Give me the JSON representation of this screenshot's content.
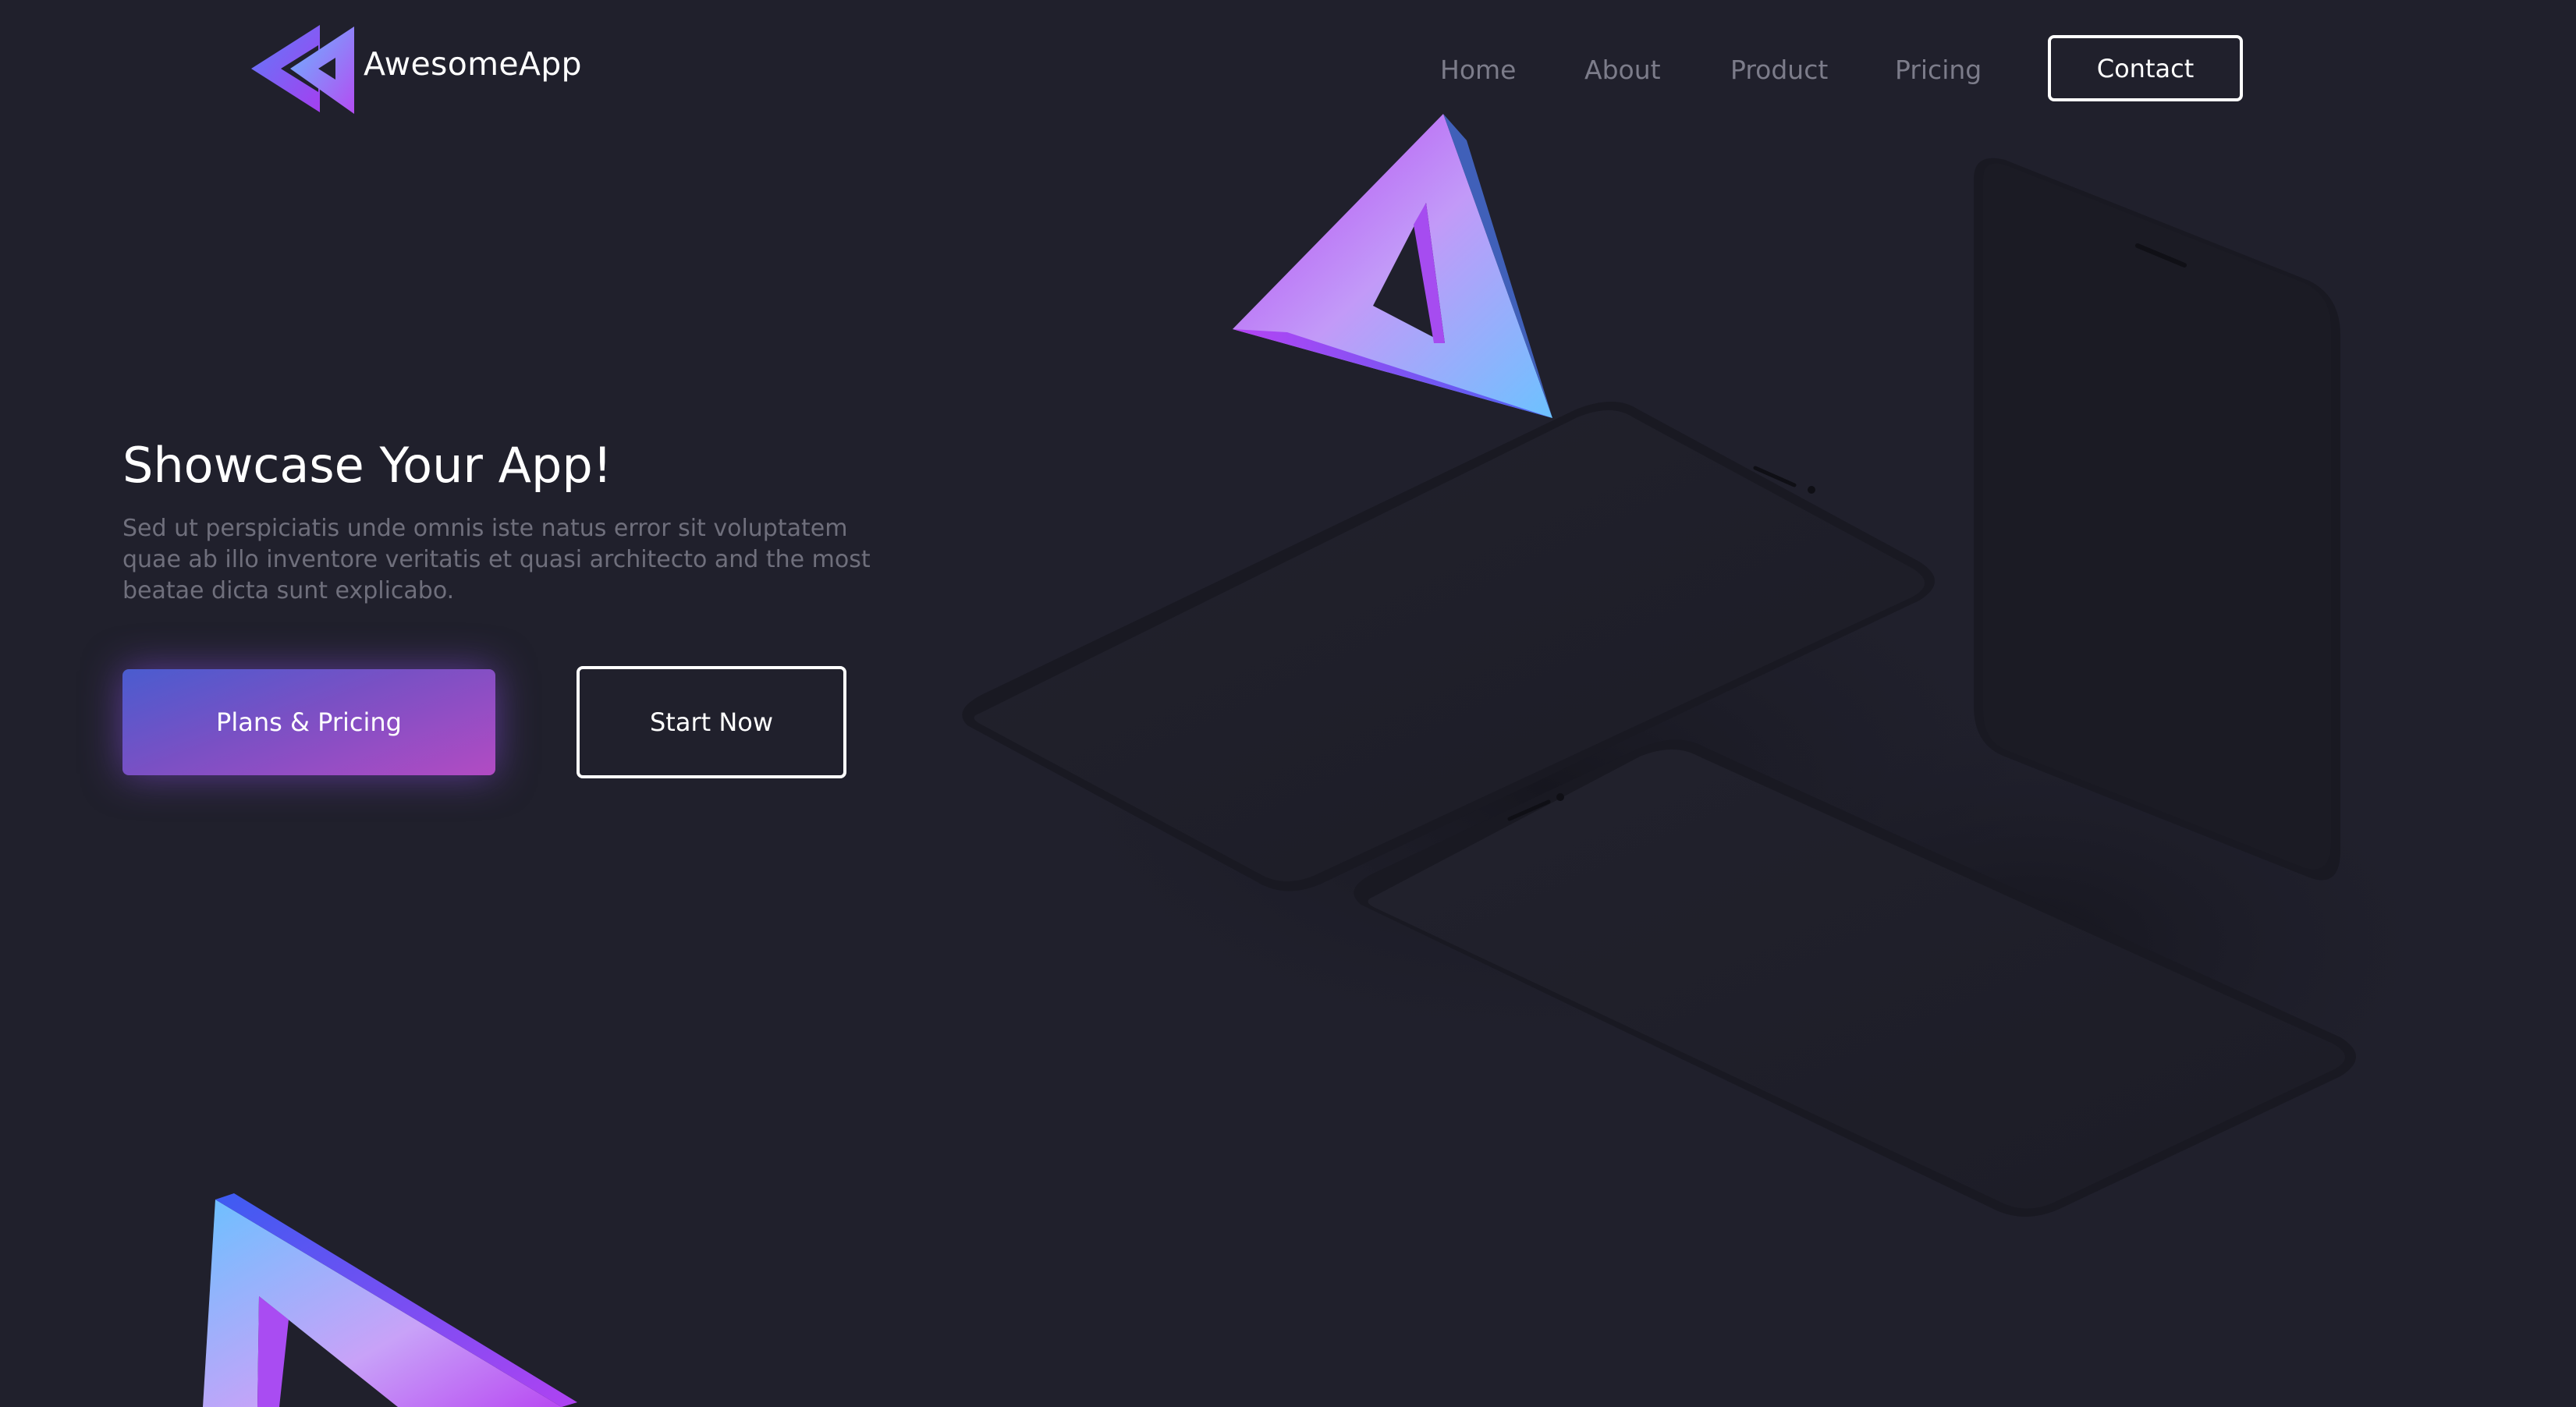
{
  "brand": {
    "name": "AwesomeApp",
    "logo_icon": "double-triangle-rewind-logo"
  },
  "nav": {
    "items": [
      {
        "label": "Home"
      },
      {
        "label": "About"
      },
      {
        "label": "Product"
      },
      {
        "label": "Pricing"
      }
    ],
    "contact_label": "Contact"
  },
  "hero": {
    "title": "Showcase Your App!",
    "description": "Sed ut perspiciatis unde omnis iste natus error sit voluptatem quae ab illo inventore veritatis et quasi architecto and the most beatae dicta sunt explicabo.",
    "primary_button": "Plans & Pricing",
    "secondary_button": "Start Now"
  },
  "colors": {
    "background": "#20202c",
    "accent_blue": "#4a6cf7",
    "accent_purple": "#b43ef0",
    "nav_text": "#7c7c8a",
    "body_text": "#6f6f7c"
  }
}
